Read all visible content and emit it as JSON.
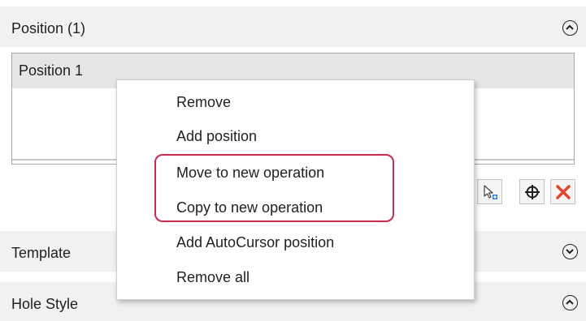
{
  "sections": {
    "position": {
      "title": "Position (1)"
    },
    "template": {
      "title": "Template"
    },
    "hole_style": {
      "title": "Hole Style"
    }
  },
  "position_list": {
    "items": [
      "Position 1"
    ]
  },
  "toolbar": {
    "icons": [
      "add-position-cursor-icon",
      "crosshair-icon",
      "delete-icon"
    ],
    "delete_color": "#e8432b"
  },
  "context_menu": {
    "items": [
      "Remove",
      "Add position",
      "Move to new operation",
      "Copy to new operation",
      "Add AutoCursor position",
      "Remove all"
    ],
    "highlight_color": "#c8294f"
  }
}
